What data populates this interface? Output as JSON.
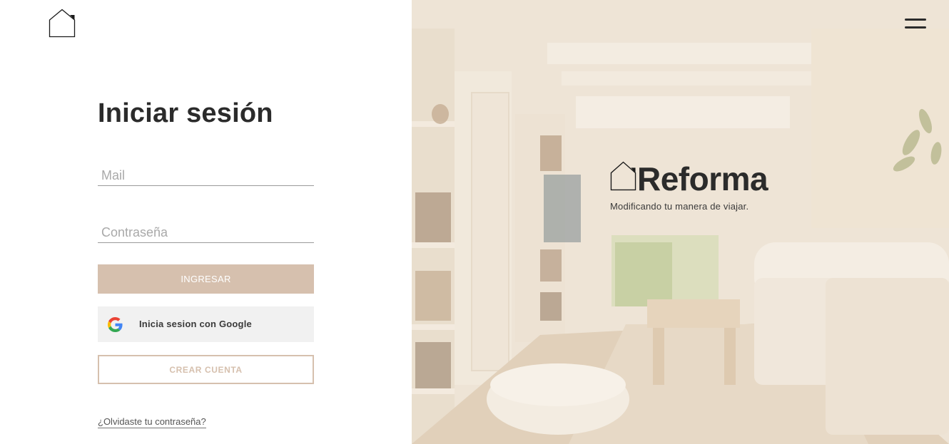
{
  "login": {
    "title": "Iniciar sesión",
    "mail_placeholder": "Mail",
    "password_placeholder": "Contraseña",
    "submit_label": "INGRESAR",
    "google_label": "Inicia sesion con Google",
    "create_label": "CREAR CUENTA",
    "forgot_label": "¿Olvidaste tu contraseña?"
  },
  "brand": {
    "name": "Reforma",
    "tagline": "Modificando tu manera de viajar."
  },
  "icons": {
    "logo": "house-outline-icon",
    "menu": "hamburger-menu-icon",
    "google": "google-g-icon"
  },
  "colors": {
    "accent": "#d6c0ae",
    "text_dark": "#2b2b2b",
    "google_button_bg": "#f1f1f1"
  }
}
